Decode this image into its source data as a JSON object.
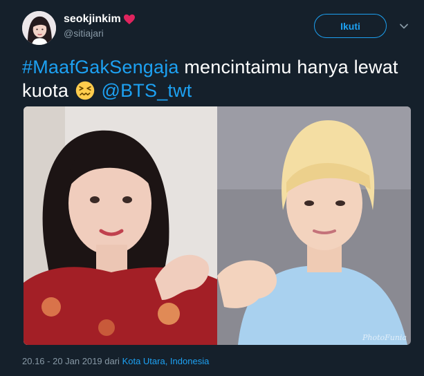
{
  "user": {
    "display_name": "seokjinkim",
    "handle": "@sitiajari"
  },
  "actions": {
    "follow_label": "Ikuti"
  },
  "tweet": {
    "hashtag": "#MaafGakSengaja",
    "text_part1": " mencintaimu hanya lewat kuota ",
    "mention": "@BTS_twt",
    "emoji": "confounded-face"
  },
  "media": {
    "watermark": "PhotoFunia"
  },
  "footer": {
    "timestamp": "20.16 - 20 Jan 2019",
    "from_label": " dari ",
    "location": "Kota Utara, Indonesia"
  },
  "colors": {
    "background": "#15202b",
    "accent": "#1da1f2",
    "secondary_text": "#8899a6",
    "heart": "#e0245e"
  }
}
